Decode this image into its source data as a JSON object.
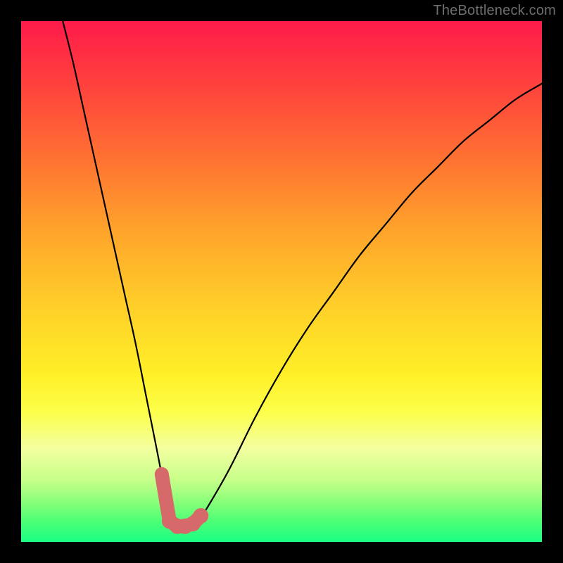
{
  "watermark": {
    "text": "TheBottleneck.com"
  },
  "colors": {
    "frame": "#000000",
    "curve": "#000000",
    "marker": "#d66a6a",
    "gradient_stops": [
      "#ff1b4a",
      "#ff3a3f",
      "#ff6d33",
      "#ffa32b",
      "#ffd029",
      "#fff027",
      "#fcff4a",
      "#f4ffa0",
      "#c8ff8a",
      "#8eff7a",
      "#4dff76",
      "#1bff83"
    ]
  },
  "chart_data": {
    "type": "line",
    "title": "",
    "xlabel": "",
    "ylabel": "",
    "xlim": [
      0,
      100
    ],
    "ylim": [
      0,
      100
    ],
    "grid": false,
    "legend": null,
    "series": [
      {
        "name": "bottleneck-curve",
        "x": [
          8,
          10,
          12,
          14,
          16,
          18,
          20,
          22,
          24,
          26,
          27,
          28,
          29,
          30,
          31,
          32,
          33,
          34,
          36,
          40,
          45,
          50,
          55,
          60,
          65,
          70,
          75,
          80,
          85,
          90,
          95,
          100
        ],
        "y": [
          100,
          92,
          83,
          74,
          65,
          56,
          47,
          38,
          28,
          18,
          13,
          9,
          6,
          4,
          3,
          3,
          3,
          4,
          7,
          14,
          24,
          33,
          41,
          48,
          55,
          61,
          67,
          72,
          77,
          81,
          85,
          88
        ]
      }
    ],
    "markers": {
      "name": "optimal-band",
      "x": [
        27,
        28.5,
        30,
        31.5,
        33,
        34.5
      ],
      "y": [
        13,
        4,
        3,
        3,
        3.5,
        5
      ]
    }
  }
}
